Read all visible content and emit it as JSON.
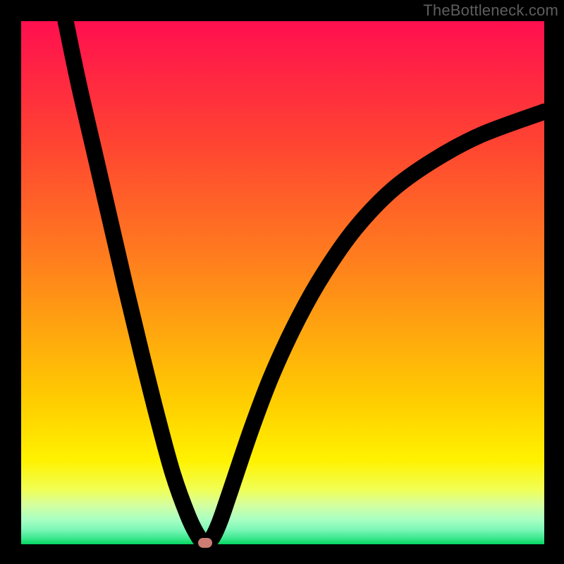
{
  "watermark": "TheBottleneck.com",
  "colors": {
    "frame_bg": "#000000",
    "gradient": {
      "c0": "#ff0f4f",
      "c1": "#ff4332",
      "c2": "#ff7f1d",
      "c3": "#ffce00",
      "c4": "#fff200",
      "c5": "#f1ff54",
      "c6": "#d4ffa0",
      "c7": "#a8ffc3",
      "c8": "#7cf7b7",
      "c9": "#3fe88f",
      "c10": "#04d662"
    },
    "curve_stroke": "#000000",
    "marker": "#cd7c73"
  },
  "chart_data": {
    "type": "line",
    "title": "",
    "xlabel": "",
    "ylabel": "",
    "xlim": [
      0,
      100
    ],
    "ylim": [
      0,
      100
    ],
    "grid": false,
    "series": [
      {
        "name": "bottleneck-curve",
        "x": [
          8.5,
          11,
          14,
          17,
          20,
          23,
          26,
          29,
          32,
          34,
          35.2,
          36.5,
          38,
          40,
          44,
          48,
          53,
          58,
          64,
          71,
          79,
          88,
          100
        ],
        "y": [
          100,
          88,
          75,
          62,
          49,
          36.5,
          24.5,
          13.5,
          5.2,
          1.3,
          0.3,
          1.2,
          4.4,
          10.2,
          22,
          32.5,
          43.2,
          52,
          60.5,
          67.8,
          73.5,
          78.3,
          82.7
        ]
      }
    ],
    "marker": {
      "x": 35.2,
      "y": 0.3,
      "shape": "rounded-pill"
    },
    "annotations": [
      {
        "text": "TheBottleneck.com",
        "role": "watermark",
        "position": "top-right"
      }
    ]
  }
}
